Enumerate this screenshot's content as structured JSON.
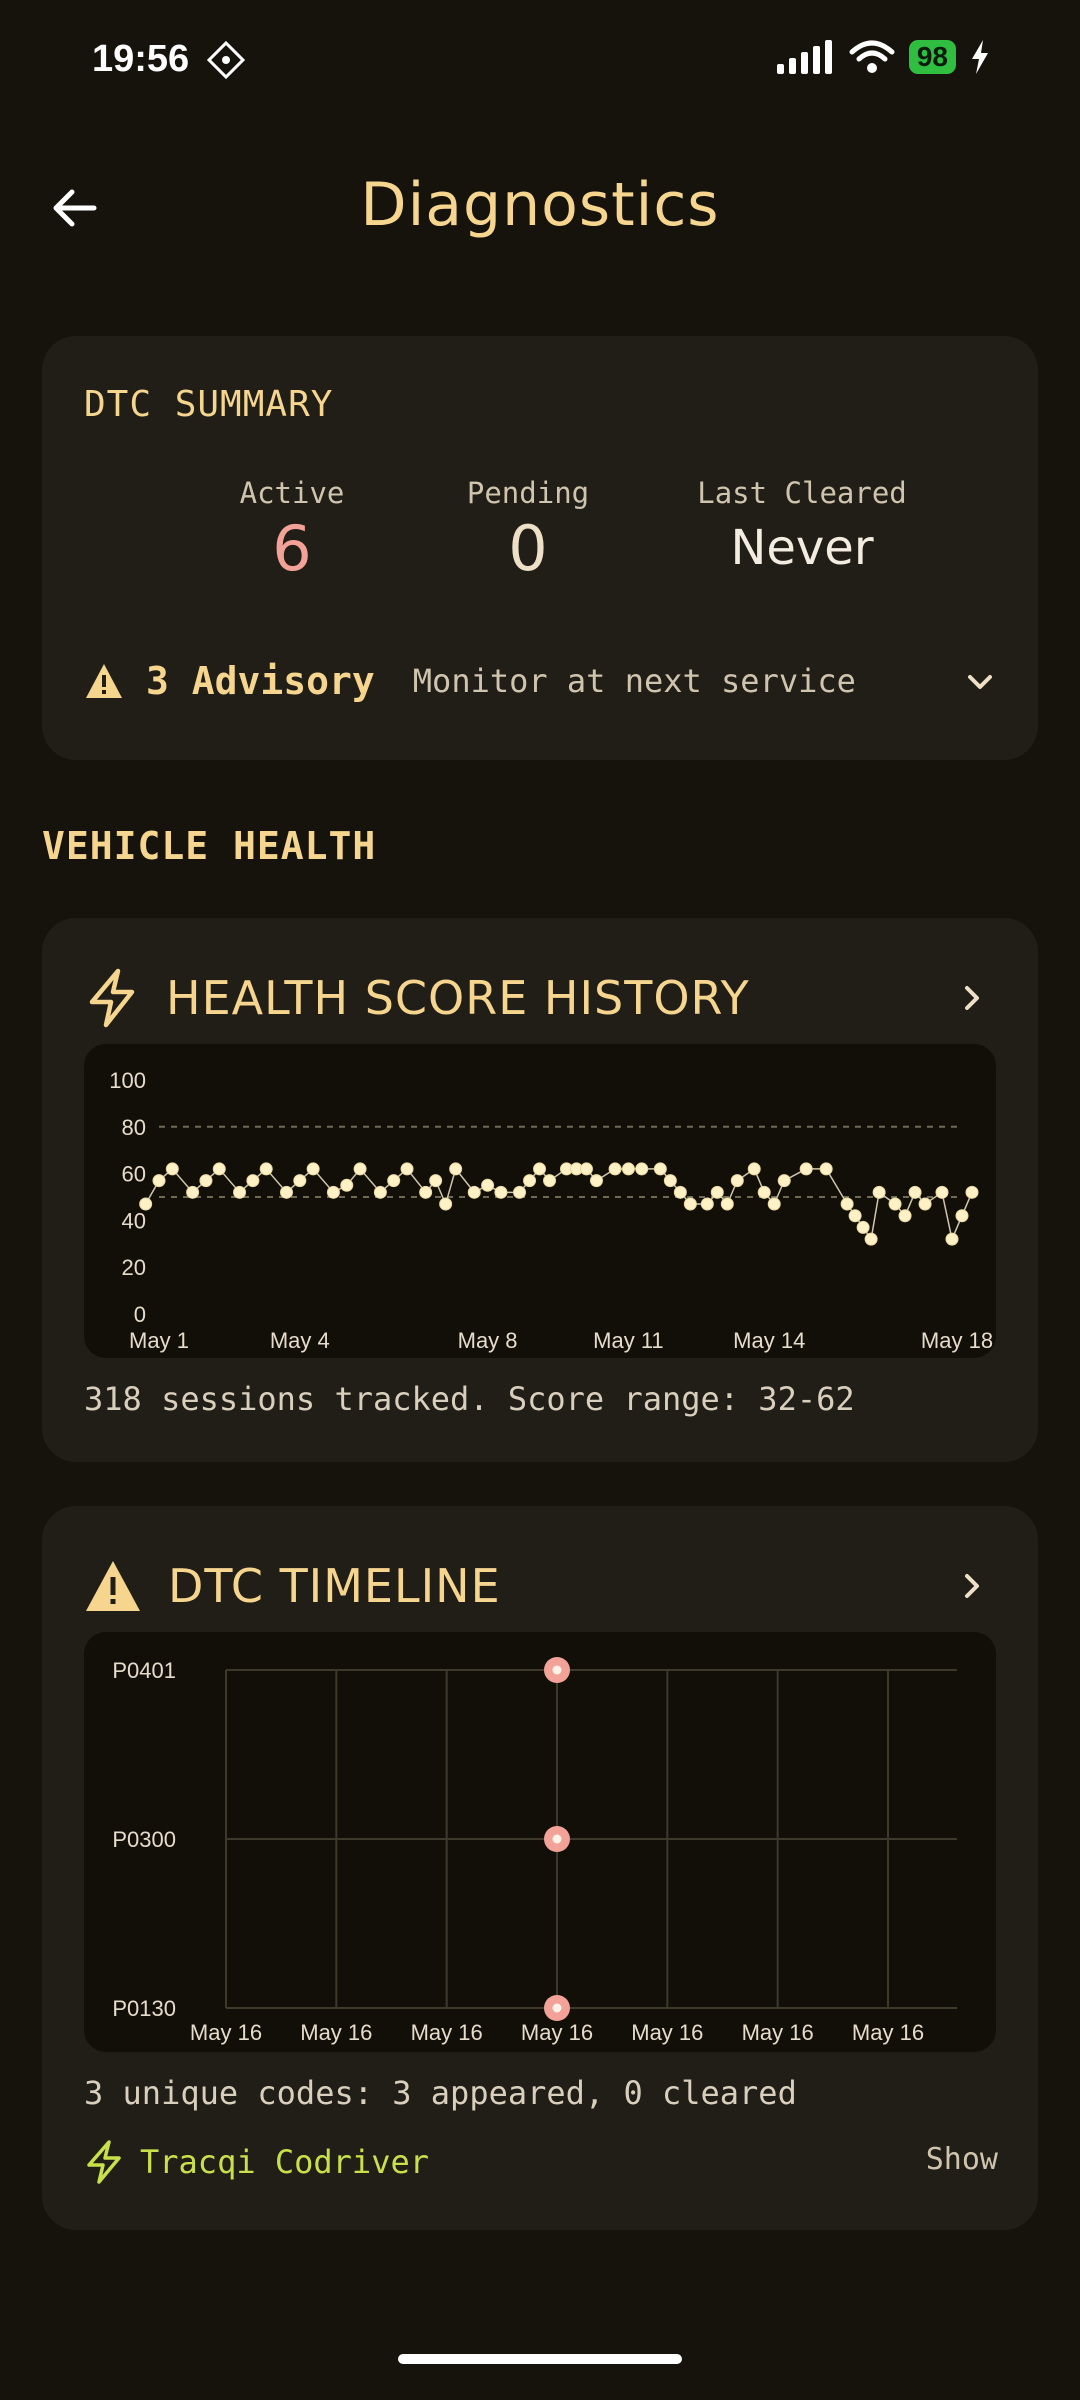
{
  "status_bar": {
    "time": "19:56",
    "battery": "98",
    "icons": [
      "cellular-signal-icon",
      "wifi-icon",
      "battery-icon",
      "charging-bolt-icon"
    ]
  },
  "header": {
    "title": "Diagnostics",
    "back_icon": "back-arrow-icon"
  },
  "dtc_summary": {
    "title": "DTC SUMMARY",
    "active_label": "Active",
    "active_value": "6",
    "pending_label": "Pending",
    "pending_value": "0",
    "last_cleared_label": "Last Cleared",
    "last_cleared_value": "Never",
    "advisory_count": "3 Advisory",
    "advisory_desc": "Monitor at next service"
  },
  "section": {
    "vehicle_health": "VEHICLE HEALTH"
  },
  "health_history": {
    "title": "HEALTH SCORE HISTORY",
    "caption": "318 sessions tracked. Score range: 32-62"
  },
  "dtc_timeline": {
    "title": "DTC TIMELINE",
    "caption": "3 unique codes: 3 appeared, 0 cleared",
    "codriver_label": "Tracqi Codriver",
    "show_label": "Show"
  },
  "colors": {
    "accent": "#f6d58e",
    "active_red": "#f3a297",
    "codriver_green": "#c8e04a",
    "background": "#16130d",
    "card": "#211e17"
  },
  "chart_data": [
    {
      "type": "scatter",
      "title": "HEALTH SCORE HISTORY",
      "ylim": [
        0,
        100
      ],
      "yticks": [
        0,
        20,
        40,
        60,
        80,
        100
      ],
      "xticks": [
        "May 1",
        "May 4",
        "May 8",
        "May 11",
        "May 14",
        "May 18"
      ],
      "reference_lines": [
        80,
        50
      ],
      "grid": false,
      "series": [
        {
          "points": [
            [
              "May 1",
              47
            ],
            [
              "May 1",
              57
            ],
            [
              "May 1",
              62
            ],
            [
              "May 2",
              52
            ],
            [
              "May 2",
              57
            ],
            [
              "May 2",
              62
            ],
            [
              "May 3",
              52
            ],
            [
              "May 3",
              57
            ],
            [
              "May 3",
              62
            ],
            [
              "May 4",
              52
            ],
            [
              "May 4",
              57
            ],
            [
              "May 4",
              62
            ],
            [
              "May 5",
              52
            ],
            [
              "May 5",
              55
            ],
            [
              "May 5",
              62
            ],
            [
              "May 6",
              52
            ],
            [
              "May 6",
              57
            ],
            [
              "May 6",
              62
            ],
            [
              "May 7",
              52
            ],
            [
              "May 7",
              57
            ],
            [
              "May 7",
              47
            ],
            [
              "May 7",
              62
            ],
            [
              "May 8",
              52
            ],
            [
              "May 8",
              55
            ],
            [
              "May 8",
              52
            ],
            [
              "May 9",
              52
            ],
            [
              "May 9",
              57
            ],
            [
              "May 9",
              62
            ],
            [
              "May 9",
              57
            ],
            [
              "May 10",
              62
            ],
            [
              "May 10",
              62
            ],
            [
              "May 10",
              62
            ],
            [
              "May 10",
              57
            ],
            [
              "May 11",
              62
            ],
            [
              "May 11",
              62
            ],
            [
              "May 11",
              62
            ],
            [
              "May 12",
              62
            ],
            [
              "May 12",
              57
            ],
            [
              "May 12",
              52
            ],
            [
              "May 12",
              47
            ],
            [
              "May 13",
              47
            ],
            [
              "May 13",
              52
            ],
            [
              "May 13",
              47
            ],
            [
              "May 13",
              57
            ],
            [
              "May 14",
              62
            ],
            [
              "May 14",
              52
            ],
            [
              "May 14",
              47
            ],
            [
              "May 14",
              57
            ],
            [
              "May 15",
              62
            ],
            [
              "May 15",
              62
            ],
            [
              "May 16",
              47
            ],
            [
              "May 16",
              42
            ],
            [
              "May 16",
              37
            ],
            [
              "May 16",
              32
            ],
            [
              "May 16",
              52
            ],
            [
              "May 17",
              47
            ],
            [
              "May 17",
              42
            ],
            [
              "May 17",
              52
            ],
            [
              "May 17",
              47
            ],
            [
              "May 18",
              52
            ],
            [
              "May 18",
              32
            ],
            [
              "May 18",
              42
            ],
            [
              "May 18",
              52
            ]
          ]
        }
      ]
    },
    {
      "type": "scatter",
      "title": "DTC TIMELINE",
      "categories_y": [
        "P0130",
        "P0300",
        "P0401"
      ],
      "xticks": [
        "May 16",
        "May 16",
        "May 16",
        "May 16",
        "May 16",
        "May 16",
        "May 16"
      ],
      "grid": true,
      "points": [
        {
          "code": "P0401",
          "x": "May 16"
        },
        {
          "code": "P0300",
          "x": "May 16"
        },
        {
          "code": "P0130",
          "x": "May 16"
        }
      ]
    }
  ]
}
